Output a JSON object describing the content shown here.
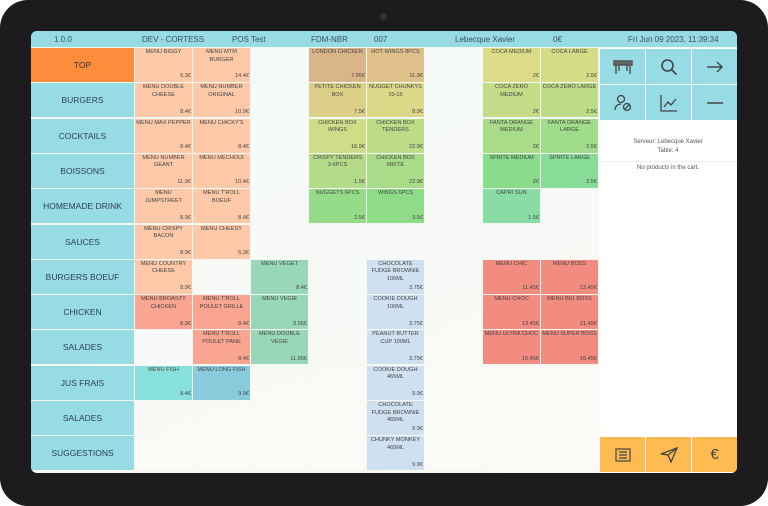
{
  "header": {
    "version": "1.0.0",
    "env": "DEV - CORTESS",
    "pos": "POS Test",
    "store": "FDM-NBR",
    "terminal": "007",
    "user": "Lebecque Xavier",
    "total": "0€",
    "datetime": "Fri Jun 09 2023, 11:39:34"
  },
  "colors": {
    "accent": "#97dbe4",
    "active": "#fd8c3c",
    "action": "#fdbb52"
  },
  "categories": [
    {
      "label": "TOP",
      "active": true
    },
    {
      "label": "BURGERS"
    },
    {
      "label": "COCKTAILS"
    },
    {
      "label": "BOISSONS"
    },
    {
      "label": "HOMEMADE DRINK"
    },
    {
      "label": "SAUCES"
    },
    {
      "label": "BURGERS BOEUF"
    },
    {
      "label": "CHICKEN"
    },
    {
      "label": "SALADES"
    },
    {
      "label": "JUS FRAIS"
    },
    {
      "label": "SALADES"
    },
    {
      "label": "SUGGESTIONS"
    }
  ],
  "products": [
    [
      {
        "name": "MENU BIGGY",
        "price": "5.3€",
        "color": "#fdc9a9"
      },
      {
        "name": "MENU MTM BURGER",
        "price": "14.4€",
        "color": "#fdc9a9"
      },
      null,
      {
        "name": "LONDON CHICKEN",
        "price": "7.95€",
        "color": "#dbb58a"
      },
      {
        "name": "HOT WINGS 8PCS",
        "price": "11.9€",
        "color": "#e0c08a"
      },
      null,
      {
        "name": "COCA MEDIUM",
        "price": "2€",
        "color": "#dcdc88"
      },
      {
        "name": "COCA LARGE",
        "price": "2.5€",
        "color": "#d4dc88"
      }
    ],
    [
      {
        "name": "MENU DOUBLE CHEESE",
        "price": "8.4€",
        "color": "#fdc9a9"
      },
      {
        "name": "MENU NUMBER ORIGINAL",
        "price": "10.9€",
        "color": "#fdc9a9"
      },
      null,
      {
        "name": "PETITE CHICKEN BOX",
        "price": "7.5€",
        "color": "#dcd088"
      },
      {
        "name": "NUGGET CHUNKYS 10-15",
        "price": "8.9€",
        "color": "#dcd888"
      },
      null,
      {
        "name": "COCA ZERO MEDIUM",
        "price": "2€",
        "color": "#c4dc88"
      },
      {
        "name": "COCA ZERO LARGE",
        "price": "2.5€",
        "color": "#bddc88"
      }
    ],
    [
      {
        "name": "MENU MAX PEPPER",
        "price": "8.4€",
        "color": "#fdc9a9"
      },
      {
        "name": "MENU CHICKY'S",
        "price": "8.4€",
        "color": "#fdc9a9"
      },
      null,
      {
        "name": "CHICKEN BOX WINGS",
        "price": "16.9€",
        "color": "#cfdc88"
      },
      {
        "name": "CHICKEN BOX TENDERS",
        "price": "22.9€",
        "color": "#bcdc88"
      },
      null,
      {
        "name": "FANTA ORANGE MEDIUM",
        "price": "2€",
        "color": "#a8dc88"
      },
      {
        "name": "FANTA ORANGE LARGE",
        "price": "2.5€",
        "color": "#a0dc8a"
      }
    ],
    [
      {
        "name": "MENU NUMBER GEANT",
        "price": "11.9€",
        "color": "#fdc9a9"
      },
      {
        "name": "MENU MECHOUI",
        "price": "10.4€",
        "color": "#fdc9a9"
      },
      null,
      {
        "name": "CRISPY TENDERS 3-6PCS",
        "price": "1.5€",
        "color": "#b4dc88"
      },
      {
        "name": "CHICKEN BOX MIXTE",
        "price": "22.9€",
        "color": "#a8dc88"
      },
      null,
      {
        "name": "SPRITE MEDIUM",
        "price": "2€",
        "color": "#88dc8a"
      },
      {
        "name": "SPRITE LARGE",
        "price": "2.5€",
        "color": "#88dc98"
      }
    ],
    [
      {
        "name": "MENU JUMPSTREET",
        "price": "8.9€",
        "color": "#fdc9a9"
      },
      {
        "name": "MENU T'ROLL BOEUF",
        "price": "8.4€",
        "color": "#fdc9a9"
      },
      null,
      {
        "name": "NUGGETS 6PCS",
        "price": "2.5€",
        "color": "#96dc88"
      },
      {
        "name": "WINGS 6PCS",
        "price": "3.5€",
        "color": "#8edc88"
      },
      null,
      {
        "name": "CAPRI SUN",
        "price": "1.5€",
        "color": "#88dca4"
      },
      null
    ],
    [
      {
        "name": "MENU CRISPY BACON",
        "price": "8.9€",
        "color": "#fdc9a9"
      },
      {
        "name": "MENU CHEESY",
        "price": "5.3€",
        "color": "#fdc9a9"
      },
      null,
      null,
      null,
      null,
      null,
      null
    ],
    [
      {
        "name": "MENU COUNTRY CHEESE",
        "price": "8.9€",
        "color": "#fdc9a9"
      },
      null,
      {
        "name": "MENU VEGET",
        "price": "8.4€",
        "color": "#98d8b8"
      },
      null,
      {
        "name": "CHOCOLATE FUDGE BROWNIE 100ML",
        "price": "3.75€",
        "color": "#cfe0f0"
      },
      null,
      {
        "name": "MENU CHIC",
        "price": "11.45€",
        "color": "#f28b80"
      },
      {
        "name": "MENU BOSS",
        "price": "12.45€",
        "color": "#f28b80"
      }
    ],
    [
      {
        "name": "MENU BROASTY CHICKEN",
        "price": "8.9€",
        "color": "#f9a592"
      },
      {
        "name": "MENU T'ROLL POULET GRILLE",
        "price": "8.4€",
        "color": "#f9a592"
      },
      {
        "name": "MENU VEGIE",
        "price": "9.95€",
        "color": "#98d8b8"
      },
      null,
      {
        "name": "COOKIE DOUGH 100ML",
        "price": "3.75€",
        "color": "#cfe0f0"
      },
      null,
      {
        "name": "MENU CHOC",
        "price": "13.45€",
        "color": "#f28b80"
      },
      {
        "name": "MENU BIG BOSS",
        "price": "21.45€",
        "color": "#f28b80"
      }
    ],
    [
      null,
      {
        "name": "MENU T'ROLL POULET PANE",
        "price": "8.4€",
        "color": "#f9a592"
      },
      {
        "name": "MENU DOUBLE VEGIE",
        "price": "11.95€",
        "color": "#98d8b8"
      },
      null,
      {
        "name": "PEANUT BUTTER CUP 100ML",
        "price": "3.75€",
        "color": "#cfe0f0"
      },
      null,
      {
        "name": "MENU ULTRA CHOC",
        "price": "15.45€",
        "color": "#f28b80"
      },
      {
        "name": "MENU SUPER BOSS",
        "price": "16.45€",
        "color": "#f28b80"
      }
    ],
    [
      {
        "name": "MENU FISH",
        "price": "8.4€",
        "color": "#88e0dc"
      },
      {
        "name": "MENU LONG FISH",
        "price": "9.9€",
        "color": "#88ccdc"
      },
      null,
      null,
      {
        "name": "COOKIE DOUGH 465ML",
        "price": "9.9€",
        "color": "#cfe0f0"
      },
      null,
      null,
      null
    ],
    [
      null,
      null,
      null,
      null,
      {
        "name": "CHOCOLATE FUDGE BROWNIE 465ML",
        "price": "9.9€",
        "color": "#cfe0f0"
      },
      null,
      null,
      null
    ],
    [
      null,
      null,
      null,
      null,
      {
        "name": "CHUNKY MONKEY 465ML",
        "price": "9.9€",
        "color": "#cfe0f0"
      },
      null,
      null,
      null
    ]
  ],
  "toolbar": [
    {
      "icon": "table-icon"
    },
    {
      "icon": "search-icon"
    },
    {
      "icon": "arrow-right-icon"
    },
    {
      "icon": "user-block-icon"
    },
    {
      "icon": "chart-icon"
    },
    {
      "icon": "minus-icon"
    }
  ],
  "cart": {
    "server": "Serveur: Lebecque Xavier",
    "table": "Table: 4",
    "empty": "No products in the cart."
  },
  "actions": [
    {
      "icon": "receipt-icon"
    },
    {
      "icon": "send-icon"
    },
    {
      "icon": "euro-icon"
    }
  ]
}
